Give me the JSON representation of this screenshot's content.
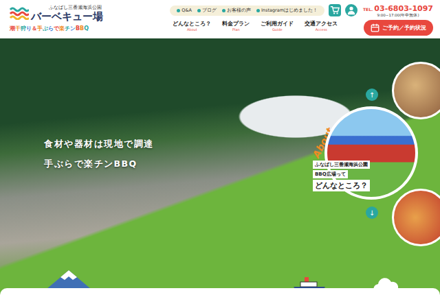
{
  "logo": {
    "park": "ふなばし三番瀬海浜公園",
    "title": "バーベキュー場",
    "tagline": "潮干狩り＆手ぶらで楽チンBBQ"
  },
  "top_links": [
    "Q&A",
    "ブログ",
    "お客様の声",
    "Instagramはじめました！"
  ],
  "contact": {
    "tel_label": "TEL.",
    "tel": "03-6803-1097",
    "hours": "9:00~17:00(年中無休)"
  },
  "nav": [
    {
      "label": "どんなところ？",
      "sub": "About"
    },
    {
      "label": "料金プラン",
      "sub": "Plan"
    },
    {
      "label": "ご利用ガイド",
      "sub": "Guide"
    },
    {
      "label": "交通アクセス",
      "sub": "Access"
    }
  ],
  "reserve_button": "ご予約／予約状況",
  "hero": {
    "lines": [
      "食材や器材は現地で調達",
      "手ぶらで楽チンBBQ"
    ]
  },
  "about_card": {
    "badge": "About",
    "lines": [
      "ふなばし三番瀬海浜公園",
      "BBQ広場って"
    ],
    "question": "どんなところ？"
  },
  "scroll_buttons": [
    "↑",
    "↓"
  ]
}
